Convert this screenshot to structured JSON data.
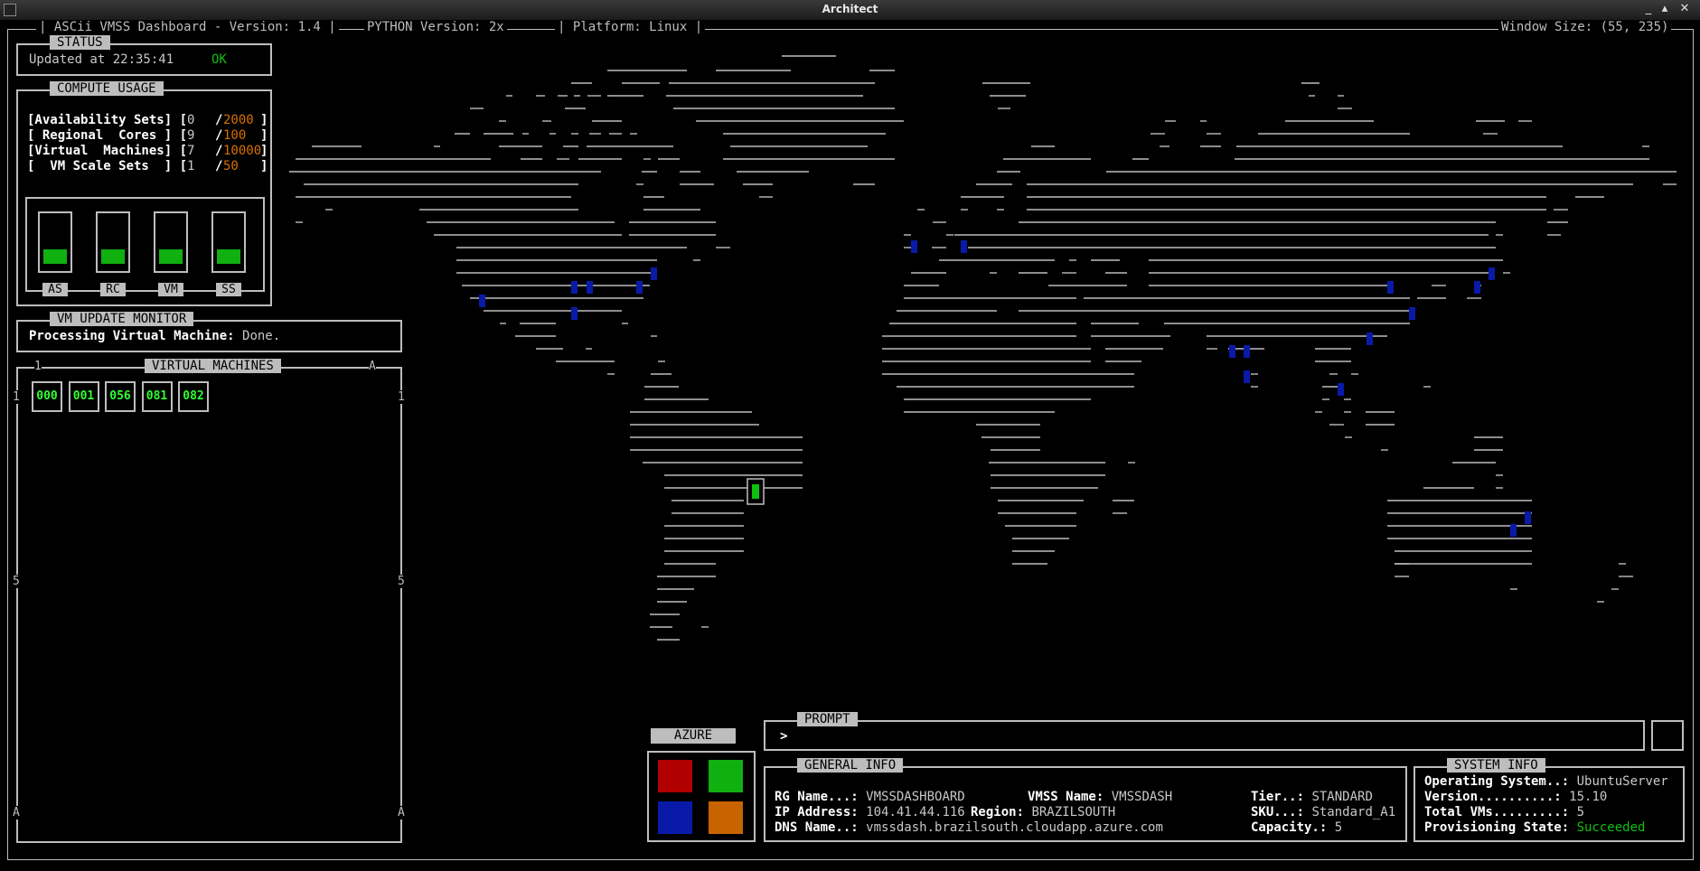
{
  "window": {
    "title": "Architect"
  },
  "header": {
    "app": "ASCii VMSS Dashboard - Version: 1.4",
    "python": "PYTHON Version: 2x",
    "platform": "Platform: Linux",
    "window_size": "Window Size: (55, 235)"
  },
  "status": {
    "label": "STATUS",
    "updated": "Updated at 22:35:41",
    "state": "OK"
  },
  "compute": {
    "label": "COMPUTE USAGE",
    "rows": [
      {
        "name": "[Availability Sets]",
        "used": "0",
        "max": "2000"
      },
      {
        "name": "[ Regional  Cores ]",
        "used": "9",
        "max": "100"
      },
      {
        "name": "[Virtual  Machines]",
        "used": "7",
        "max": "10000"
      },
      {
        "name": "[  VM Scale Sets  ]",
        "used": "1",
        "max": "50"
      }
    ],
    "gauges": [
      {
        "label": "AS",
        "level": 0.25
      },
      {
        "label": "RC",
        "level": 0.25
      },
      {
        "label": "VM",
        "level": 0.25
      },
      {
        "label": "SS",
        "level": 0.25
      }
    ]
  },
  "monitor": {
    "label": "VM UPDATE MONITOR",
    "key": "Processing Virtual Machine:",
    "value": "Done."
  },
  "vms": {
    "label": "VIRTUAL MACHINES",
    "ids": [
      "000",
      "001",
      "056",
      "081",
      "082"
    ],
    "top_left": "1",
    "top_right": "A",
    "left_1": "1",
    "right_1": "1",
    "left_5": "5",
    "right_5": "5",
    "left_a": "A",
    "right_a": "A"
  },
  "azure": {
    "label": "AZURE",
    "colors": [
      "#b00000",
      "#10b010",
      "#0a1aa8",
      "#c86400"
    ]
  },
  "prompt": {
    "label": "PROMPT",
    "symbol": ">"
  },
  "general": {
    "label": "GENERAL INFO",
    "rg_key": "RG Name...:",
    "rg_val": "VMSSDASHBOARD",
    "ip_key": "IP Address:",
    "ip_val": "104.41.44.116",
    "dns_key": "DNS Name..:",
    "dns_val": "vmssdash.brazilsouth.cloudapp.azure.com",
    "vmss_key": "VMSS Name:",
    "vmss_val": "VMSSDASH",
    "region_key": "Region:",
    "region_val": "BRAZILSOUTH",
    "tier_key": "Tier..:",
    "tier_val": "STANDARD",
    "sku_key": "SKU...:",
    "sku_val": "Standard_A1",
    "cap_key": "Capacity.:",
    "cap_val": "5"
  },
  "system": {
    "label": "SYSTEM INFO",
    "os_key": "Operating System..:",
    "os_val": "UbuntuServer",
    "ver_key": "Version..........:",
    "ver_val": "15.10",
    "total_key": "Total VMs.........:",
    "total_val": "5",
    "prov_key": "Provisioning State:",
    "prov_val": "Succeeded"
  }
}
